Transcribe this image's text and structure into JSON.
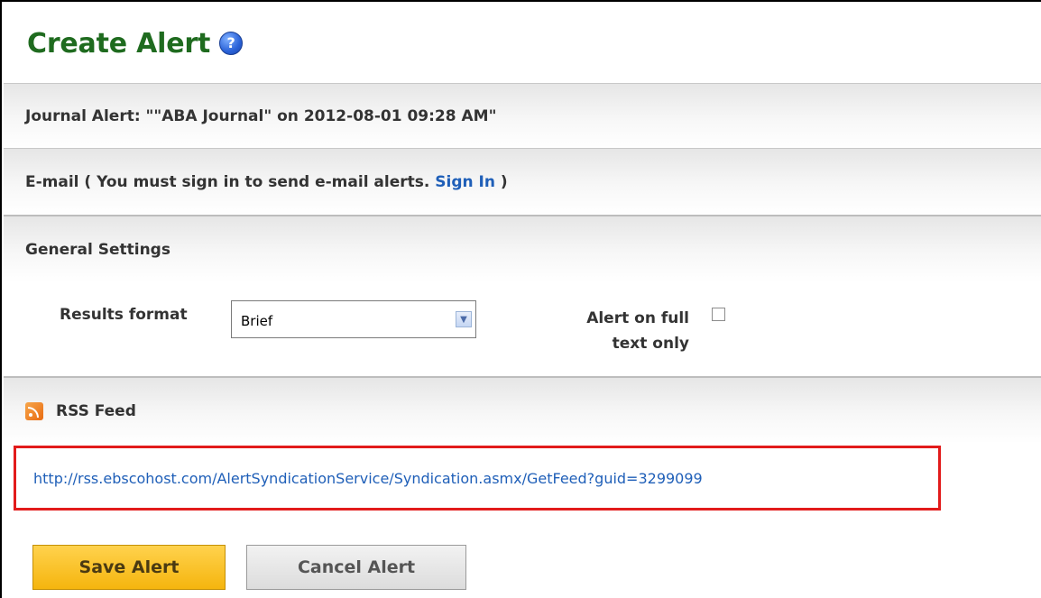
{
  "header": {
    "title": "Create Alert",
    "help_icon_glyph": "?"
  },
  "journal_alert": {
    "label": "Journal Alert: \"\"ABA Journal\" on 2012-08-01 09:28 AM\""
  },
  "email": {
    "prefix": "E-mail ( You must sign in to send e-mail alerts.",
    "sign_in_link": "Sign In",
    "suffix": ")"
  },
  "general_settings": {
    "heading": "General Settings",
    "results_format_label": "Results format",
    "results_format_value": "Brief",
    "full_text_label_line1": "Alert on full",
    "full_text_label_line2": "text only",
    "full_text_checked": false
  },
  "rss": {
    "heading": "RSS Feed",
    "feed_url": "http://rss.ebscohost.com/AlertSyndicationService/Syndication.asmx/GetFeed?guid=3299099"
  },
  "actions": {
    "save_label": "Save Alert",
    "cancel_label": "Cancel Alert"
  },
  "colors": {
    "title": "#1f6b1f",
    "link": "#1f5fb8",
    "highlight_border": "#e21b1b",
    "save_button": "#f5b50e"
  }
}
